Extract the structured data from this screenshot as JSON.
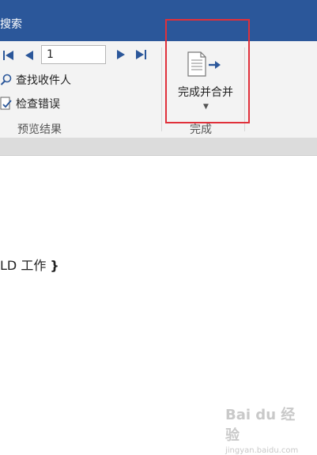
{
  "titlebar": {
    "title": "搜索"
  },
  "ribbon": {
    "preview_group": {
      "record_value": "1",
      "find_recipient_label": "查找收件人",
      "check_errors_label": "检查错误",
      "group_label": "预览结果"
    },
    "finish_group": {
      "finish_merge_label": "完成并合并",
      "group_label": "完成"
    }
  },
  "document": {
    "field_text": "LD  工作",
    "closing_brace": "}"
  },
  "watermark": {
    "brand": "Bai du 经验",
    "url": "jingyan.baidu.com"
  },
  "colors": {
    "titlebar": "#2b579a",
    "nav_arrows": "#2b579a",
    "highlight": "#e0303a"
  }
}
